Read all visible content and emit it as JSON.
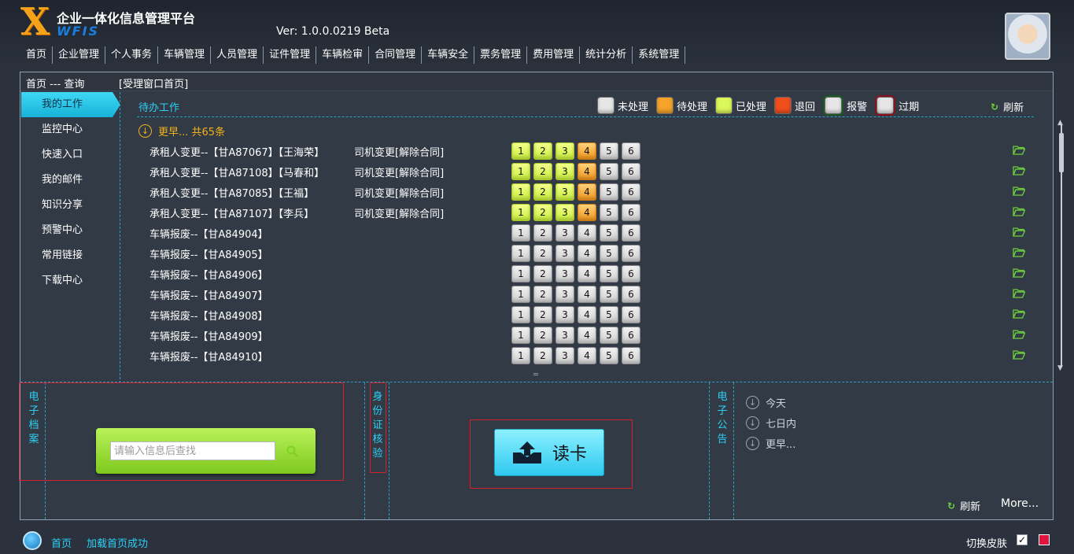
{
  "header": {
    "logo_letter": "X",
    "logo_sub": "WFIS",
    "title": "企业一体化信息管理平台",
    "version": "Ver: 1.0.0.0219 Beta"
  },
  "nav": [
    "首页",
    "企业管理",
    "个人事务",
    "车辆管理",
    "人员管理",
    "证件管理",
    "车辆检审",
    "合同管理",
    "车辆安全",
    "票务管理",
    "费用管理",
    "统计分析",
    "系统管理"
  ],
  "panel": {
    "breadcrumb": "首页 --- 查询",
    "subtitle": "[受理窗口首页]"
  },
  "sidebar": [
    "我的工作",
    "监控中心",
    "快速入口",
    "我的邮件",
    "知识分享",
    "预警中心",
    "常用链接",
    "下载中心"
  ],
  "work": {
    "title": "待办工作",
    "legend": [
      {
        "label": "未处理",
        "color": "#e6e6e6"
      },
      {
        "label": "待处理",
        "color": "#f5a32a"
      },
      {
        "label": "已处理",
        "color": "#dcf75a"
      },
      {
        "label": "退回",
        "color": "#f04f1c"
      },
      {
        "label": "报警",
        "color": "#e6e6e6",
        "ring": "#1a5a22"
      },
      {
        "label": "过期",
        "color": "#e6e6e6",
        "ring": "#8a1020"
      }
    ],
    "refresh": "刷新",
    "group": "更早... 共65条",
    "rows": [
      {
        "text": "承租人变更--【甘A87067】【王海荣】",
        "extra": "司机变更[解除合同]",
        "steps": [
          "done",
          "done",
          "done",
          "pending",
          "none",
          "none"
        ]
      },
      {
        "text": "承租人变更--【甘A87108】【马春和】",
        "extra": "司机变更[解除合同]",
        "steps": [
          "done",
          "done",
          "done",
          "pending",
          "none",
          "none"
        ]
      },
      {
        "text": "承租人变更--【甘A87085】【王福】",
        "extra": "司机变更[解除合同]",
        "steps": [
          "done",
          "done",
          "done",
          "pending",
          "none",
          "none"
        ]
      },
      {
        "text": "承租人变更--【甘A87107】【李兵】",
        "extra": "司机变更[解除合同]",
        "steps": [
          "done",
          "done",
          "done",
          "pending",
          "none",
          "none"
        ]
      },
      {
        "text": "车辆报废--【甘A84904】",
        "extra": "",
        "steps": [
          "none",
          "none",
          "none",
          "none",
          "none",
          "none"
        ]
      },
      {
        "text": "车辆报废--【甘A84905】",
        "extra": "",
        "steps": [
          "none",
          "none",
          "none",
          "none",
          "none",
          "none"
        ]
      },
      {
        "text": "车辆报废--【甘A84906】",
        "extra": "",
        "steps": [
          "none",
          "none",
          "none",
          "none",
          "none",
          "none"
        ]
      },
      {
        "text": "车辆报废--【甘A84907】",
        "extra": "",
        "steps": [
          "none",
          "none",
          "none",
          "none",
          "none",
          "none"
        ]
      },
      {
        "text": "车辆报废--【甘A84908】",
        "extra": "",
        "steps": [
          "none",
          "none",
          "none",
          "none",
          "none",
          "none"
        ]
      },
      {
        "text": "车辆报废--【甘A84909】",
        "extra": "",
        "steps": [
          "none",
          "none",
          "none",
          "none",
          "none",
          "none"
        ]
      },
      {
        "text": "车辆报废--【甘A84910】",
        "extra": "",
        "steps": [
          "none",
          "none",
          "none",
          "none",
          "none",
          "none"
        ]
      }
    ],
    "step_labels": [
      "1",
      "2",
      "3",
      "4",
      "5",
      "6"
    ]
  },
  "bottom": {
    "archive_label": "电子档案",
    "search_placeholder": "请输入信息后查找",
    "id_label": "身份证核验",
    "read_card": "读卡",
    "notice_label": "电子公告",
    "notices": [
      "今天",
      "七日内",
      "更早..."
    ],
    "refresh": "刷新",
    "more": "More..."
  },
  "status": {
    "home": "首页",
    "message": "加载首页成功",
    "skin_label": "切换皮肤",
    "check_mark": "✓",
    "skin_color": "#e0123e"
  }
}
